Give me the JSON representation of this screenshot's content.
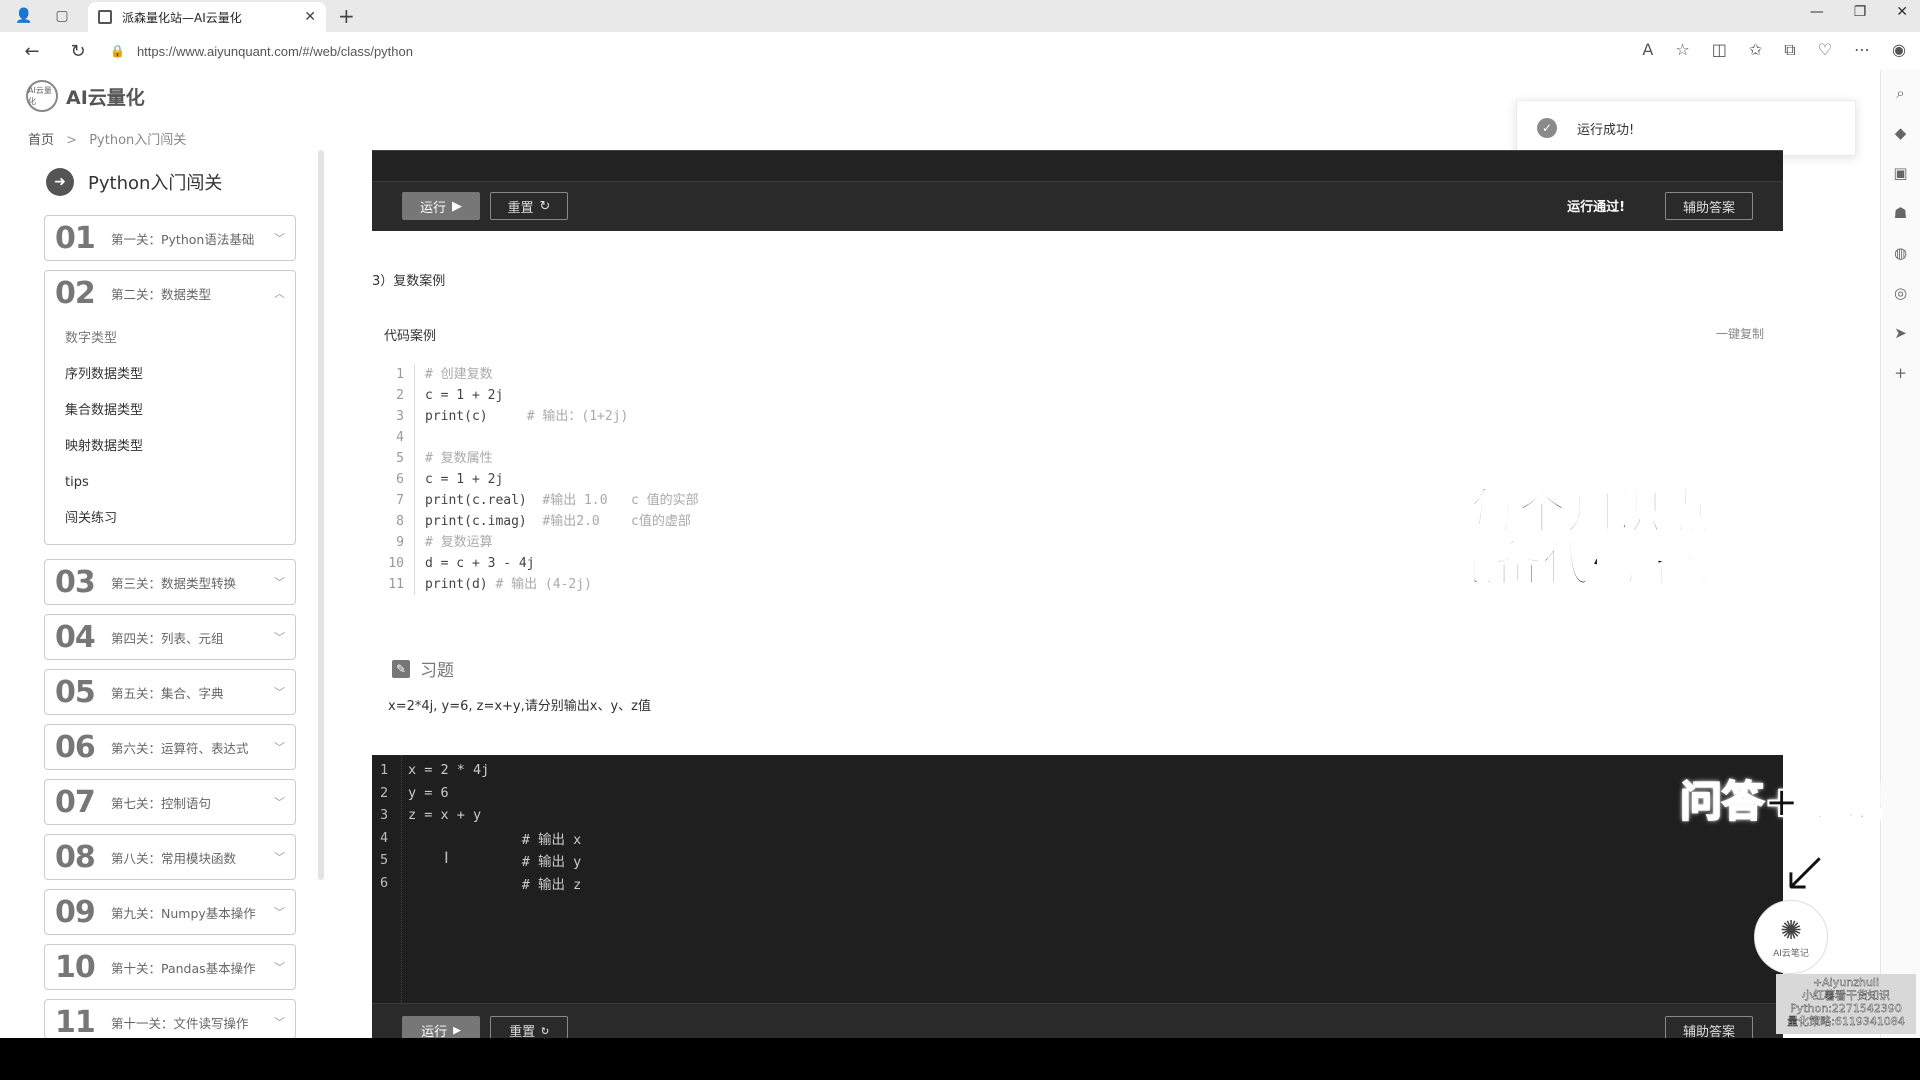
{
  "browser": {
    "tab_title": "派森量化站—AI云量化",
    "url": "https://www.aiyunquant.com/#/web/class/python"
  },
  "site": {
    "logo_text": "AI云量化",
    "logo_mark": "AI云量化"
  },
  "breadcrumb": {
    "home": "首页",
    "current": "Python入门闯关"
  },
  "toast": {
    "message": "运行成功!"
  },
  "sidebar": {
    "title": "Python入门闯关",
    "lessons": [
      {
        "num": "01",
        "title": "第一关：Python语法基础"
      },
      {
        "num": "02",
        "title": "第二关：数据类型"
      },
      {
        "num": "03",
        "title": "第三关：数据类型转换"
      },
      {
        "num": "04",
        "title": "第四关：列表、元组"
      },
      {
        "num": "05",
        "title": "第五关：集合、字典"
      },
      {
        "num": "06",
        "title": "第六关：运算符、表达式"
      },
      {
        "num": "07",
        "title": "第七关：控制语句"
      },
      {
        "num": "08",
        "title": "第八关：常用模块函数"
      },
      {
        "num": "09",
        "title": "第九关：Numpy基本操作"
      },
      {
        "num": "10",
        "title": "第十关：Pandas基本操作"
      },
      {
        "num": "11",
        "title": "第十一关：文件读写操作"
      }
    ],
    "sub_items": [
      "数字类型",
      "序列数据类型",
      "集合数据类型",
      "映射数据类型",
      "tips",
      "闯关练习"
    ]
  },
  "top_panel": {
    "run_label": "运行",
    "reset_label": "重置",
    "status": "运行通过!",
    "answer_label": "辅助答案"
  },
  "section": {
    "title": "3）复数案例",
    "code_label": "代码案例",
    "copy_label": "一键复制",
    "code_lines": [
      {
        "n": "1",
        "code": "",
        "comment": "# 创建复数"
      },
      {
        "n": "2",
        "code": "c = 1 + 2j",
        "comment": ""
      },
      {
        "n": "3",
        "code": "print(c)     ",
        "comment": "# 输出：(1+2j)"
      },
      {
        "n": "4",
        "code": "",
        "comment": ""
      },
      {
        "n": "5",
        "code": "",
        "comment": "# 复数属性"
      },
      {
        "n": "6",
        "code": "c = 1 + 2j",
        "comment": ""
      },
      {
        "n": "7",
        "code": "print(c.real)  ",
        "comment": "#输出 1.0   c 值的实部"
      },
      {
        "n": "8",
        "code": "print(c.imag)  ",
        "comment": "#输出2.0    c值的虚部"
      },
      {
        "n": "9",
        "code": "",
        "comment": "# 复数运算"
      },
      {
        "n": "10",
        "code": "d = c + 3 - 4j",
        "comment": ""
      },
      {
        "n": "11",
        "code": "print(d) ",
        "comment": "# 输出 (4-2j)"
      }
    ]
  },
  "overlay": {
    "line1": "每个知识点",
    "line2": "配备代码案例",
    "qa": "问答+笔记",
    "ai_badge": "AI云笔记"
  },
  "exercise": {
    "title": "习题",
    "description": "x=2*4j, y=6, z=x+y,请分别输出x、y、z值",
    "editor_lines": [
      {
        "n": "1",
        "text": "x = 2 * 4j"
      },
      {
        "n": "2",
        "text": "y = 6"
      },
      {
        "n": "3",
        "text": "z = x + y"
      },
      {
        "n": "4",
        "text": "              # 输出 x"
      },
      {
        "n": "5",
        "text": "              # 输出 y"
      },
      {
        "n": "6",
        "text": "              # 输出 z"
      }
    ],
    "run_label": "运行",
    "reset_label": "重置",
    "answer_label": "辅助答案"
  },
  "watermark": {
    "lines": [
      "+Aiyunzhuli",
      "小红薯看干货知识",
      "Python:2271542390",
      "量化策略:6119341084"
    ]
  },
  "colors": {
    "dark_panel": "#222222",
    "accent_run": "#777777"
  }
}
